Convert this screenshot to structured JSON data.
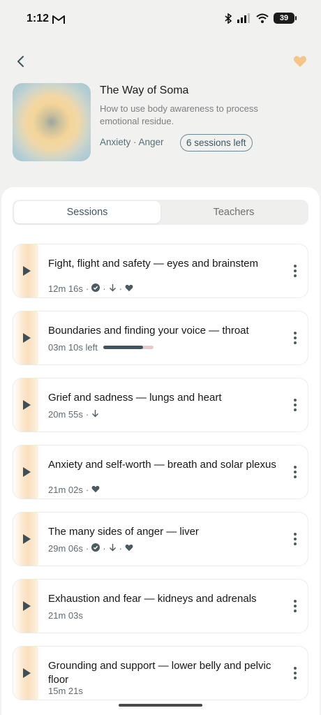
{
  "status": {
    "time": "1:12",
    "battery": "39"
  },
  "header": {
    "title": "The Way of Soma",
    "description": "How to use body awareness to process emotional residue.",
    "tags": "Anxiety · Anger",
    "sessions_left": "6 sessions left"
  },
  "tabs": [
    {
      "label": "Sessions"
    },
    {
      "label": "Teachers"
    }
  ],
  "sessions": [
    {
      "title": "Fight, flight and safety — eyes and brainstem",
      "duration": "12m 16s",
      "completed": true,
      "downloaded": true,
      "favorited": true
    },
    {
      "title": "Boundaries and finding your voice — throat",
      "duration": "03m 10s left",
      "progress": 0.8
    },
    {
      "title": "Grief and sadness — lungs and heart",
      "duration": "20m 55s",
      "downloaded": true
    },
    {
      "title": "Anxiety and self-worth — breath and solar plexus",
      "duration": "21m 02s",
      "favorited": true
    },
    {
      "title": "The many sides of anger — liver",
      "duration": "29m 06s",
      "completed": true,
      "downloaded": true,
      "favorited": true
    },
    {
      "title": "Exhaustion and fear — kidneys and adrenals",
      "duration": "21m 03s"
    },
    {
      "title": "Grounding and support — lower belly and pelvic floor",
      "duration": "15m 21s"
    }
  ],
  "colors": {
    "accent": "#3d5561",
    "favorite": "#f5c58a",
    "progress_track": "#e9c9c9"
  }
}
